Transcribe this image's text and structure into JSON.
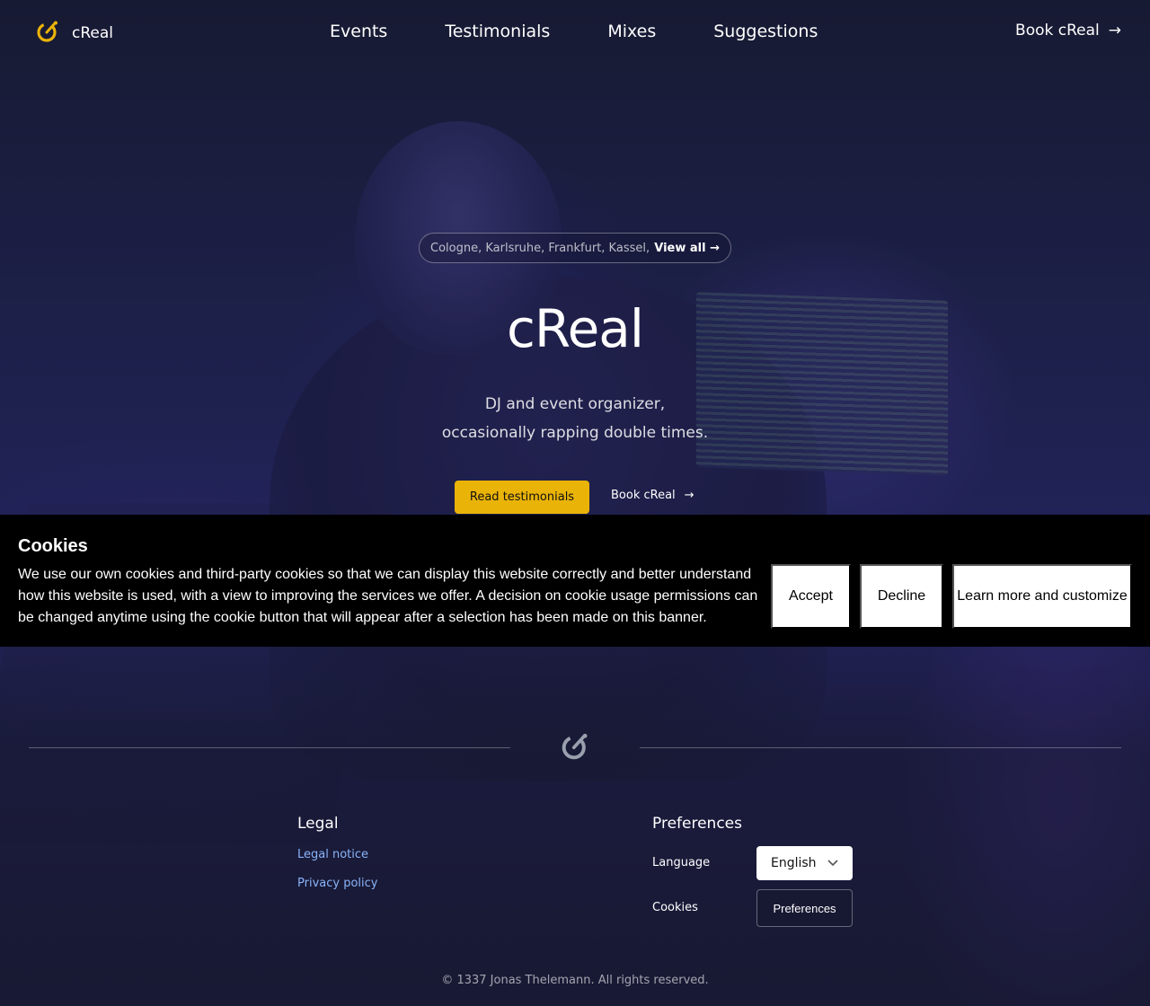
{
  "brand": {
    "name": "cReal",
    "logo_icon": "creal-logo-icon",
    "accent": "#eab308"
  },
  "nav": {
    "items": [
      "Events",
      "Testimonials",
      "Mixes",
      "Suggestions"
    ]
  },
  "header": {
    "book_label": "Book cReal",
    "book_arrow": "→"
  },
  "hero": {
    "cities": "Cologne, Karlsruhe, Frankfurt, Kassel, ⋯",
    "view_all": "View all →",
    "title": "cReal",
    "subtitle_line1": "DJ and event organizer,",
    "subtitle_line2": "occasionally rapping double times.",
    "primary_button": "Read testimonials",
    "secondary_link": "Book cReal",
    "secondary_arrow": "→"
  },
  "cookie_banner": {
    "title": "Cookies",
    "text": "We use our own cookies and third-party cookies so that we can display this website correctly and better understand how this website is used, with a view to improving the services we offer. A decision on cookie usage permissions can be changed anytime using the cookie button that will appear after a selection has been made on this banner.",
    "accept": "Accept",
    "decline": "Decline",
    "learn_more": "Learn more and customize"
  },
  "footer": {
    "legal": {
      "title": "Legal",
      "links": [
        "Legal notice",
        "Privacy policy"
      ]
    },
    "preferences": {
      "title": "Preferences",
      "language_label": "Language",
      "language_value": "English",
      "cookies_label": "Cookies",
      "cookies_button": "Preferences"
    },
    "copyright": "© 1337 Jonas Thelemann. All rights reserved."
  }
}
